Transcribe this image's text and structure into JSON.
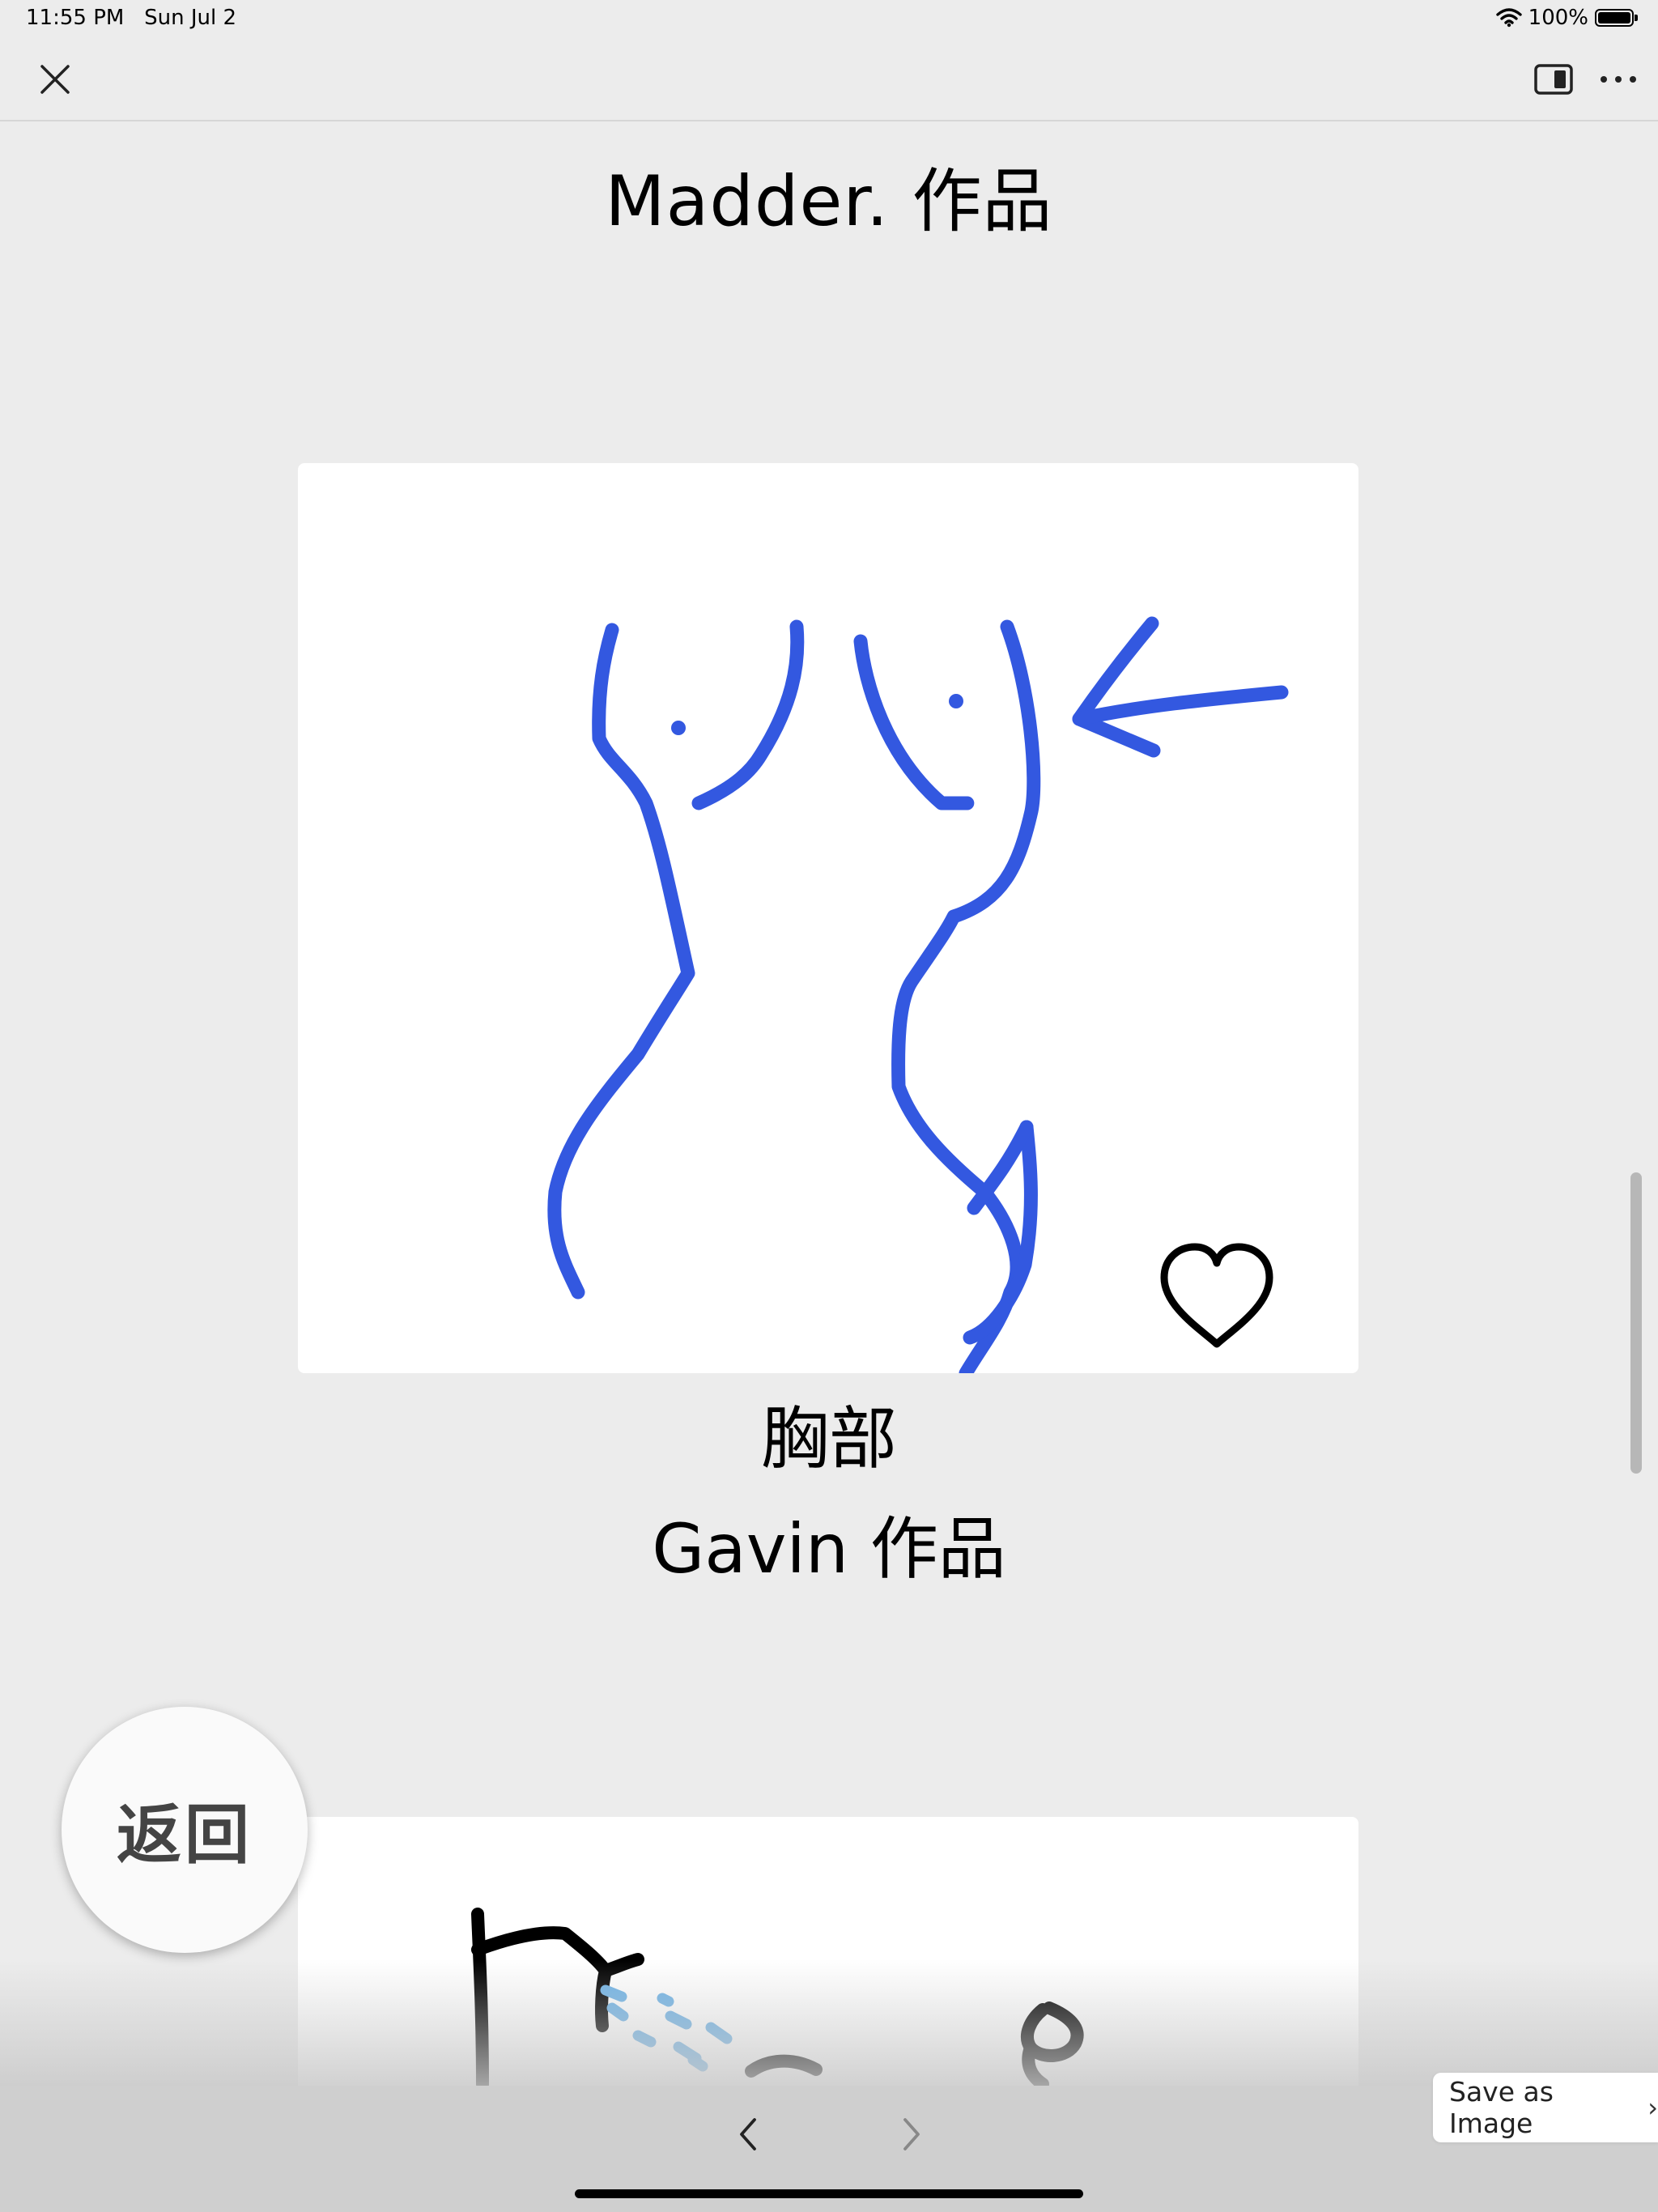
{
  "status_bar": {
    "time": "11:55 PM",
    "date": "Sun Jul 2",
    "battery_percent": "100%",
    "battery_level": 1.0
  },
  "toolbar": {
    "close_icon": "close-icon",
    "sidebar_icon": "sidebar-toggle-icon",
    "more_icon": "more-icon"
  },
  "page": {
    "title": "Madder. 作品",
    "artworks": [
      {
        "caption": "胸部",
        "author": "Gavin 作品",
        "favorite_icon": "heart-outline-icon",
        "stroke_color": "#3358e0"
      },
      {
        "caption": "",
        "author": "",
        "stroke_color": "#000000",
        "accent_color": "#6fb3e6"
      }
    ]
  },
  "back_button": {
    "label": "返回"
  },
  "save_button": {
    "label": "Save as Image",
    "chevron": "›"
  },
  "nav": {
    "back_icon": "chevron-left-icon",
    "forward_icon": "chevron-right-icon"
  }
}
